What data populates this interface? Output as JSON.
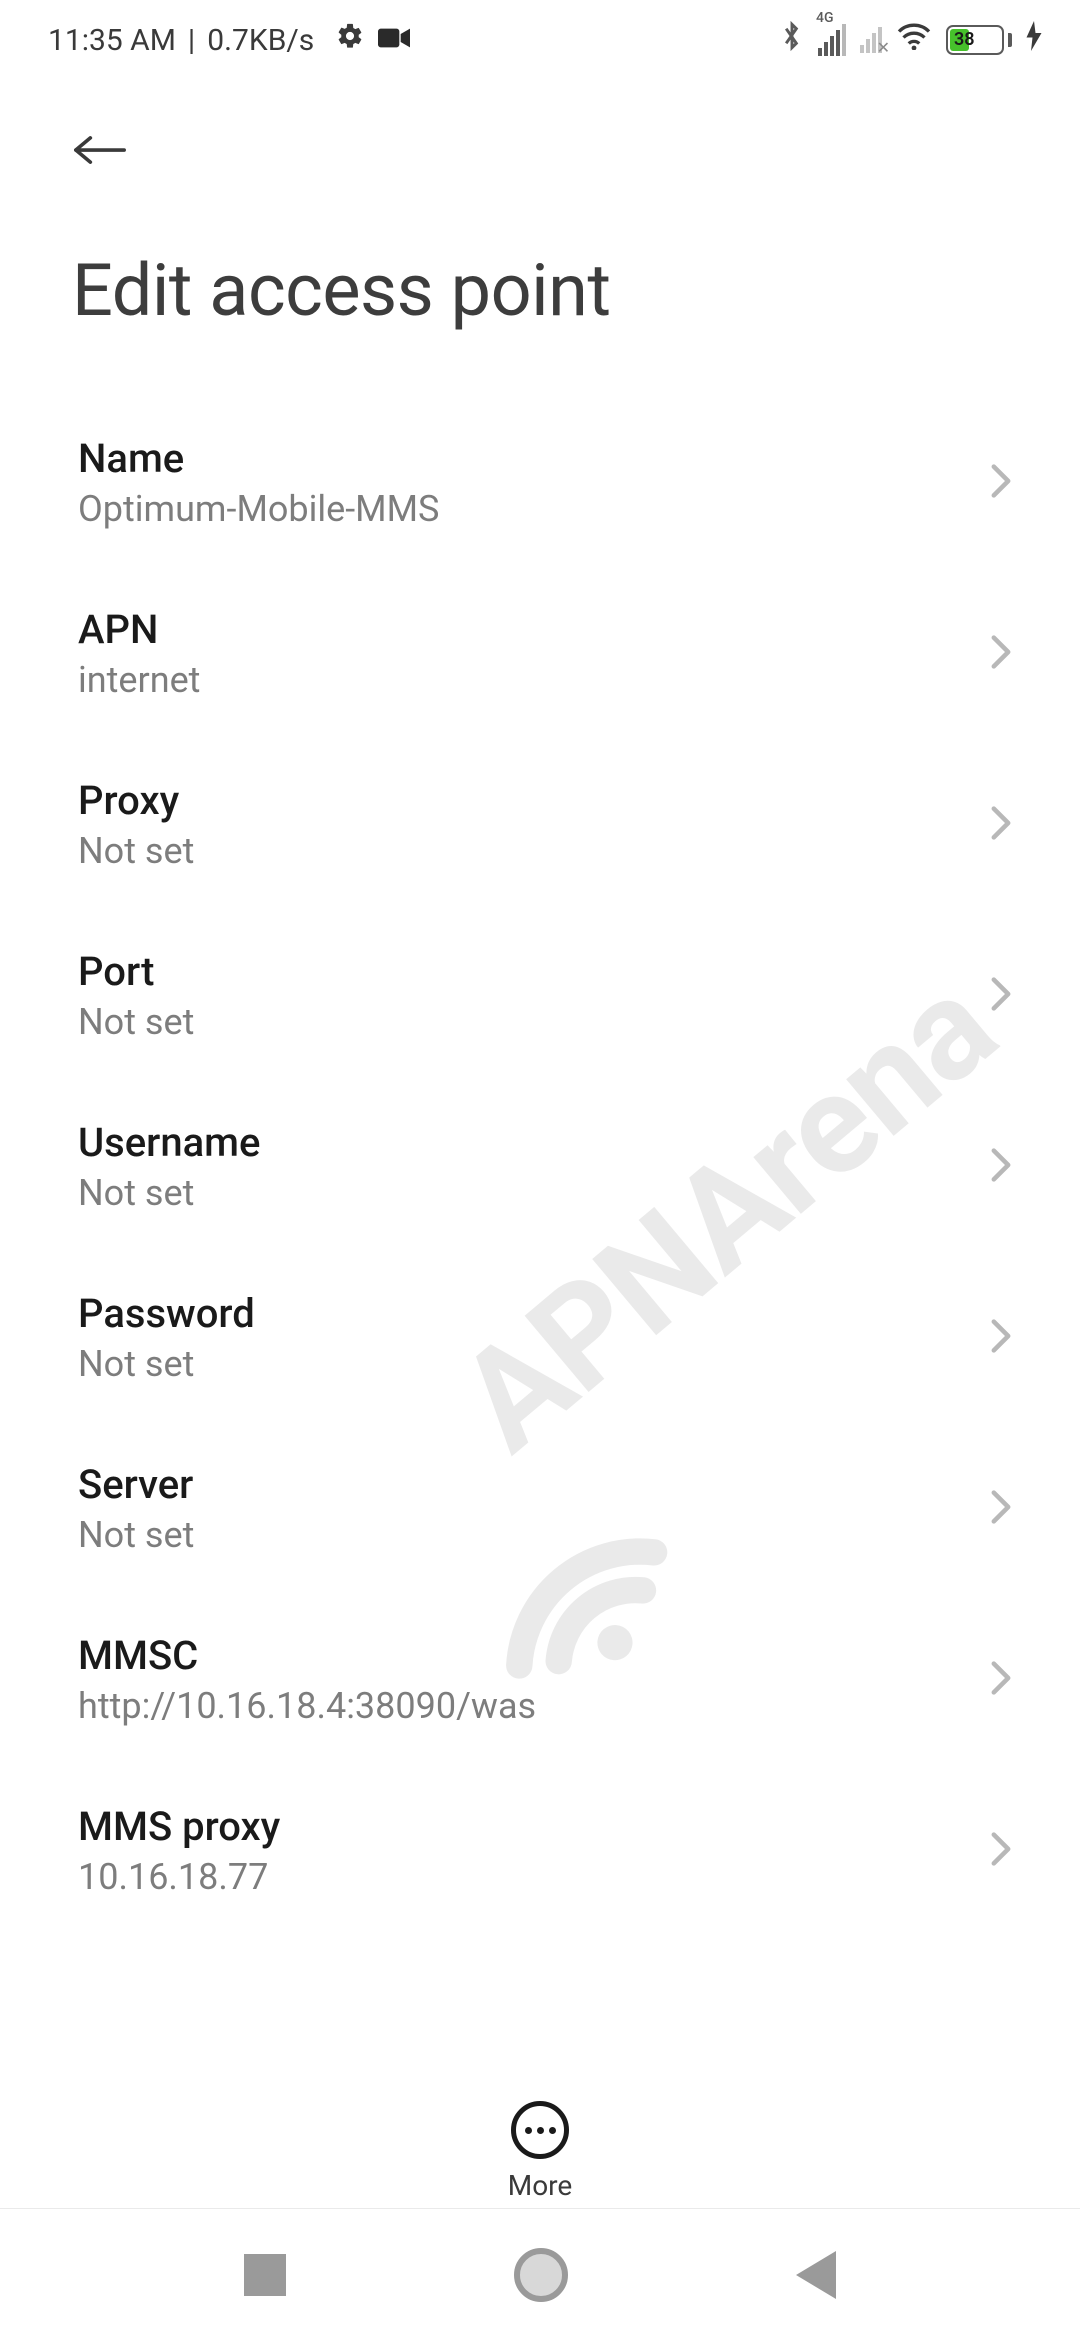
{
  "status": {
    "time": "11:35 AM",
    "separator": "|",
    "speed": "0.7KB/s",
    "network_label": "4G",
    "battery_percent": "38"
  },
  "header": {
    "title": "Edit access point"
  },
  "settings": [
    {
      "label": "Name",
      "value": "Optimum-Mobile-MMS"
    },
    {
      "label": "APN",
      "value": "internet"
    },
    {
      "label": "Proxy",
      "value": "Not set"
    },
    {
      "label": "Port",
      "value": "Not set"
    },
    {
      "label": "Username",
      "value": "Not set"
    },
    {
      "label": "Password",
      "value": "Not set"
    },
    {
      "label": "Server",
      "value": "Not set"
    },
    {
      "label": "MMSC",
      "value": "http://10.16.18.4:38090/was"
    },
    {
      "label": "MMS proxy",
      "value": "10.16.18.77"
    }
  ],
  "bottom": {
    "more": "More"
  },
  "watermark": {
    "brand": "APNArena"
  }
}
